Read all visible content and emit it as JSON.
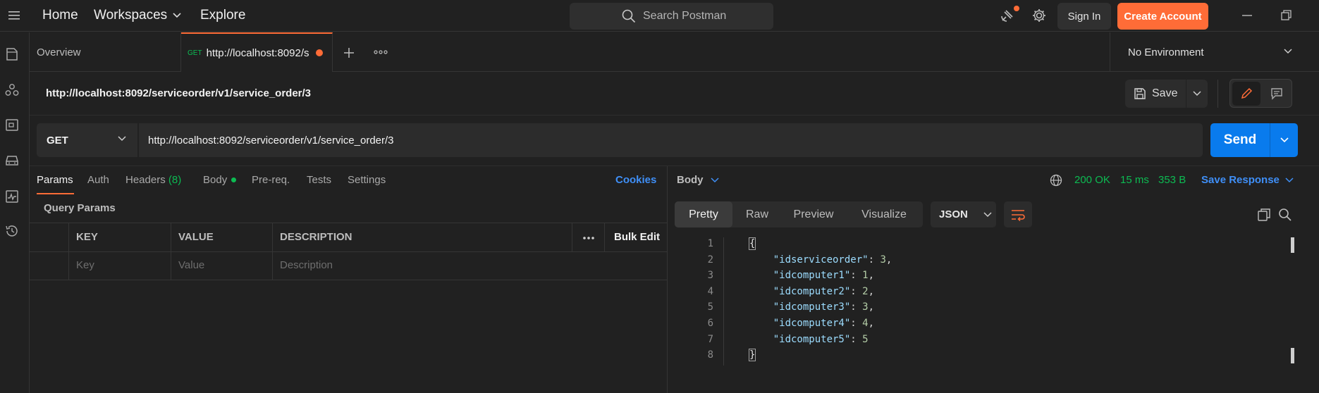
{
  "nav": {
    "home": "Home",
    "workspaces": "Workspaces",
    "explore": "Explore",
    "search_placeholder": "Search Postman",
    "sign_in": "Sign In",
    "create_account": "Create Account"
  },
  "colors": {
    "accent": "#ff6c37",
    "primary": "#097bed",
    "success": "#0cbb52",
    "link": "#3f8ff7"
  },
  "sidebar": {
    "icons": [
      "collections-icon",
      "apis-icon",
      "environments-icon",
      "mock-servers-icon",
      "monitors-icon",
      "history-icon"
    ]
  },
  "tabs": {
    "overview": "Overview",
    "active": {
      "method": "GET",
      "label": "http://localhost:8092/s",
      "unsaved": true
    }
  },
  "environment": {
    "selected": "No Environment"
  },
  "request": {
    "title": "http://localhost:8092/serviceorder/v1/service_order/3",
    "save_label": "Save",
    "method": "GET",
    "url": "http://localhost:8092/serviceorder/v1/service_order/3",
    "send_label": "Send"
  },
  "request_tabs": {
    "params": "Params",
    "auth": "Auth",
    "headers": "Headers",
    "headers_count": "(8)",
    "body": "Body",
    "prereq": "Pre-req.",
    "tests": "Tests",
    "settings": "Settings",
    "cookies": "Cookies"
  },
  "query_params": {
    "title": "Query Params",
    "columns": {
      "key": "KEY",
      "value": "VALUE",
      "description": "DESCRIPTION"
    },
    "bulk_edit": "Bulk Edit",
    "placeholder_row": {
      "key": "Key",
      "value": "Value",
      "description": "Description"
    }
  },
  "response": {
    "body_label": "Body",
    "status": "200 OK",
    "time": "15 ms",
    "size": "353 B",
    "save_response": "Save Response",
    "views": [
      "Pretty",
      "Raw",
      "Preview",
      "Visualize"
    ],
    "active_view": "Pretty",
    "format": "JSON",
    "lines": [
      {
        "n": "1",
        "text": "{"
      },
      {
        "n": "2",
        "key": "\"idserviceorder\"",
        "value": "3",
        "comma": true
      },
      {
        "n": "3",
        "key": "\"idcomputer1\"",
        "value": "1",
        "comma": true
      },
      {
        "n": "4",
        "key": "\"idcomputer2\"",
        "value": "2",
        "comma": true
      },
      {
        "n": "5",
        "key": "\"idcomputer3\"",
        "value": "3",
        "comma": true
      },
      {
        "n": "6",
        "key": "\"idcomputer4\"",
        "value": "4",
        "comma": true
      },
      {
        "n": "7",
        "key": "\"idcomputer5\"",
        "value": "5",
        "comma": false
      },
      {
        "n": "8",
        "text": "}"
      }
    ]
  }
}
